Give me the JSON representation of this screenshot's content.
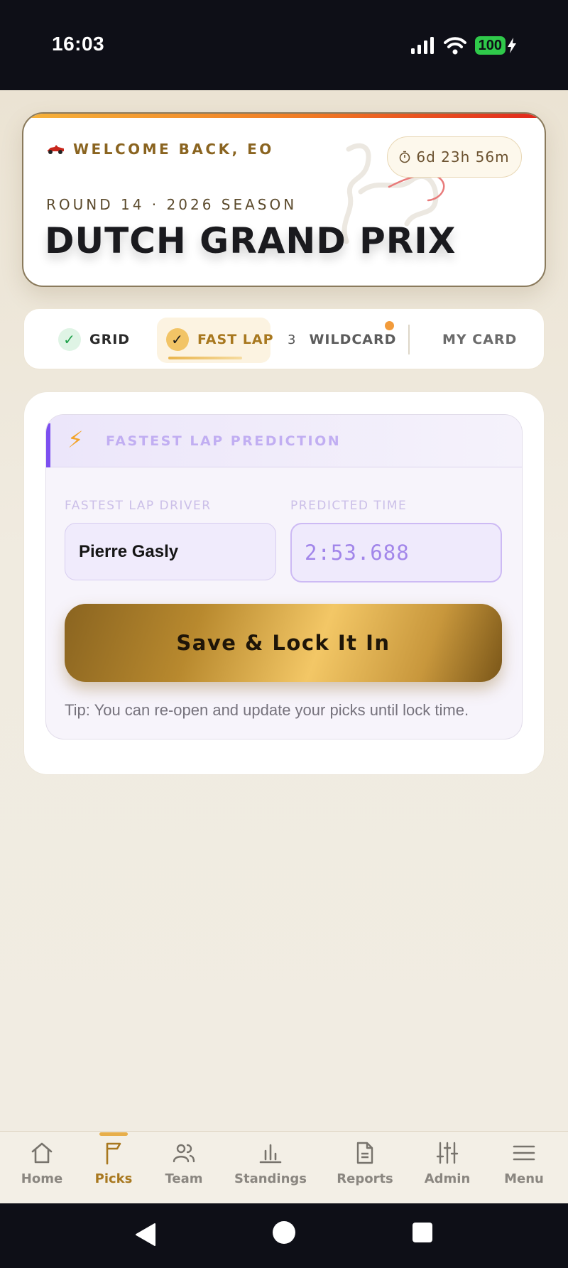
{
  "status_bar": {
    "time": "16:03",
    "battery": "100"
  },
  "hero": {
    "welcome": "WELCOME BACK, EO",
    "countdown": "6d 23h 56m",
    "round": "ROUND 14 · 2026 SEASON",
    "title": "DUTCH GRAND PRIX"
  },
  "tabs": {
    "grid": "GRID",
    "fast_lap": "FAST LAP",
    "wildcard_count": "3",
    "wildcard": "WILDCARD",
    "my_card": "MY CARD"
  },
  "prediction": {
    "section_title": "FASTEST LAP PREDICTION",
    "driver_label": "FASTEST LAP DRIVER",
    "driver_value": "Pierre Gasly",
    "time_label": "PREDICTED TIME",
    "time_value": "2:53.688",
    "save_label": "Save & Lock It In",
    "tip": "Tip: You can re-open and update your picks until lock time."
  },
  "bottom_nav": {
    "items": [
      {
        "label": "Home",
        "icon": "home-icon"
      },
      {
        "label": "Picks",
        "icon": "flag-icon",
        "active": true
      },
      {
        "label": "Team",
        "icon": "team-icon"
      },
      {
        "label": "Standings",
        "icon": "standings-icon"
      },
      {
        "label": "Reports",
        "icon": "document-icon"
      },
      {
        "label": "Admin",
        "icon": "sliders-icon"
      },
      {
        "label": "Menu",
        "icon": "menu-icon"
      }
    ]
  },
  "colors": {
    "accent_gold": "#a8781f",
    "accent_purple": "#7c4ff0",
    "background": "#f1ece1"
  }
}
